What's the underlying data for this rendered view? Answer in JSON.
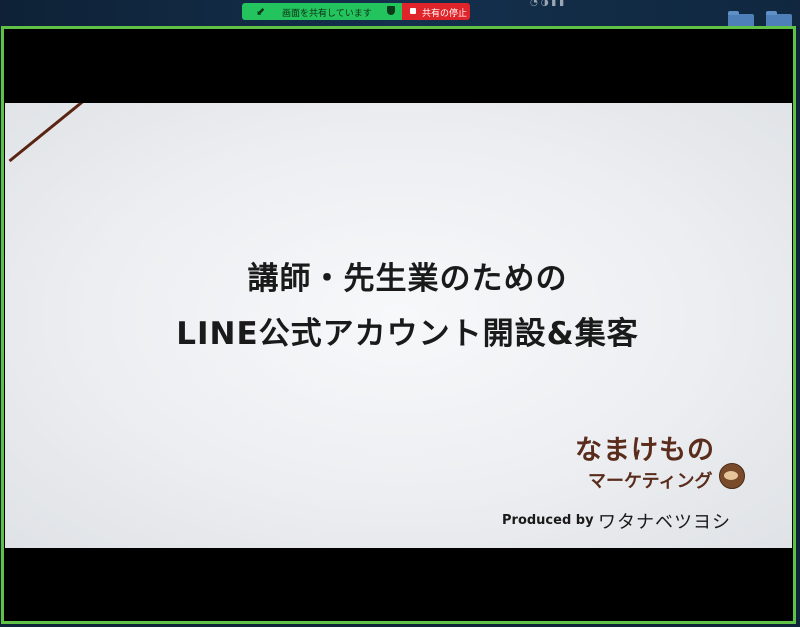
{
  "share_bar": {
    "status_label": "画面を共有しています",
    "stop_label": "共有の停止"
  },
  "slide": {
    "title_line1": "講師・先生業のための",
    "title_line2": "LINE公式アカウント開設&集客",
    "brand_main": "なまけもの",
    "brand_sub": "マーケティング",
    "producer_label": "Produced by",
    "producer_name": "ワタナベツヨシ"
  },
  "colors": {
    "share_border": "#5fc247",
    "share_status_bg": "#23c45e",
    "stop_bg": "#e0242a",
    "brand": "#5a2c1b"
  },
  "icons": {
    "grip": "drag-grip-icon",
    "shield": "security-shield-icon",
    "stop": "stop-square-icon",
    "folder": "folder-icon"
  }
}
